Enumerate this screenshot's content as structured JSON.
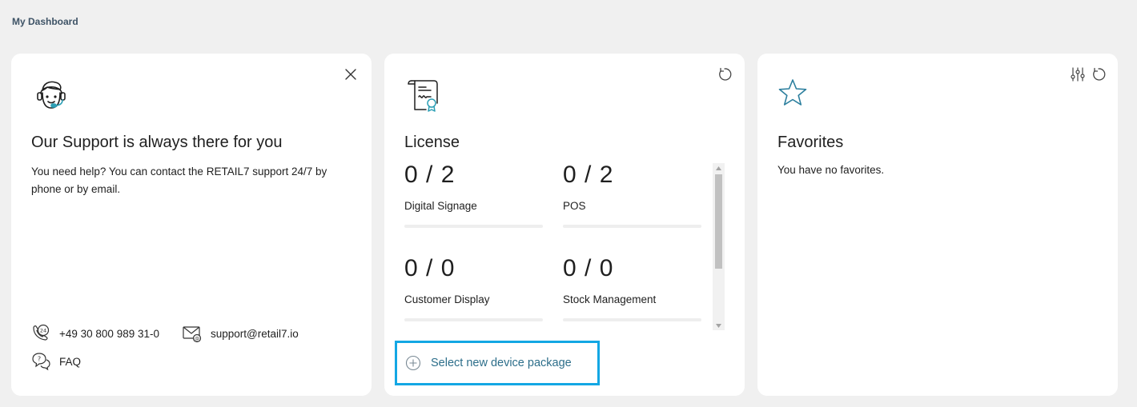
{
  "header": {
    "title": "My Dashboard"
  },
  "support": {
    "title": "Our Support is always there for you",
    "text": "You need help? You can contact the RETAIL7 support 24/7 by phone or by email.",
    "phone": "+49 30 800 989 31-0",
    "email": "support@retail7.io",
    "faq": "FAQ",
    "icons": {
      "main": "support-agent-icon",
      "close": "close-icon",
      "phone": "phone-24-icon",
      "email": "email-icon",
      "faq": "faq-icon"
    }
  },
  "license": {
    "title": "License",
    "items": [
      {
        "value": "0 / 2",
        "label": "Digital Signage",
        "used": 0,
        "total": 2
      },
      {
        "value": "0 / 2",
        "label": "POS",
        "used": 0,
        "total": 2
      },
      {
        "value": "0 / 0",
        "label": "Customer Display",
        "used": 0,
        "total": 0
      },
      {
        "value": "0 / 0",
        "label": "Stock Management",
        "used": 0,
        "total": 0
      }
    ],
    "action": "Select new device package",
    "icons": {
      "main": "license-certificate-icon",
      "refresh": "refresh-icon",
      "action": "plus-circle-icon"
    }
  },
  "favorites": {
    "title": "Favorites",
    "empty_text": "You have no favorites.",
    "icons": {
      "main": "star-icon",
      "settings": "sliders-icon",
      "refresh": "refresh-icon"
    }
  },
  "colors": {
    "accent": "#2c7f9e",
    "highlight": "#13a7e4",
    "background": "#f0f0f0"
  }
}
